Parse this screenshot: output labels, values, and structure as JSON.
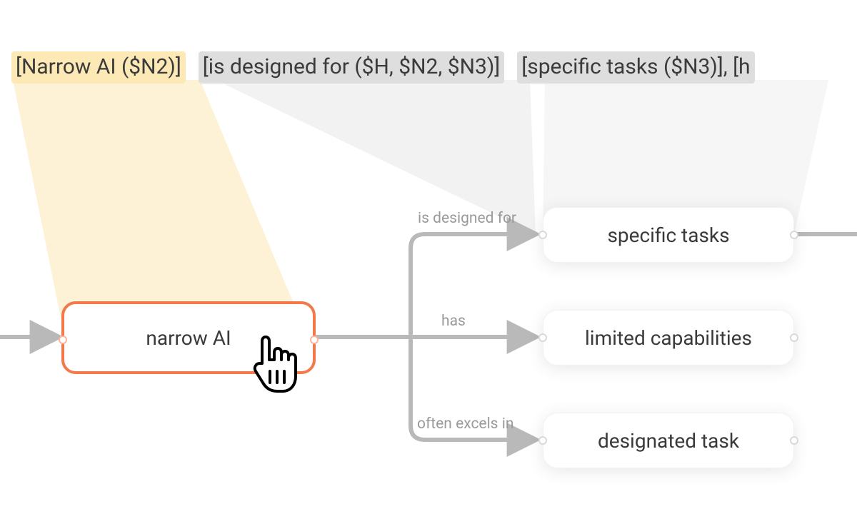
{
  "tokens": {
    "t0": "[Narrow AI ($N2)]",
    "t1": "[is designed for ($H, $N2, $N3)]",
    "t2": "[specific tasks ($N3)], [h"
  },
  "nodes": {
    "narrow_ai": "narrow AI",
    "specific_tasks": "specific tasks",
    "limited_capabilities": "limited capabilities",
    "designated_task": "designated task"
  },
  "edges": {
    "designed_for": "is designed for",
    "has": "has",
    "excels": "often excels in"
  }
}
